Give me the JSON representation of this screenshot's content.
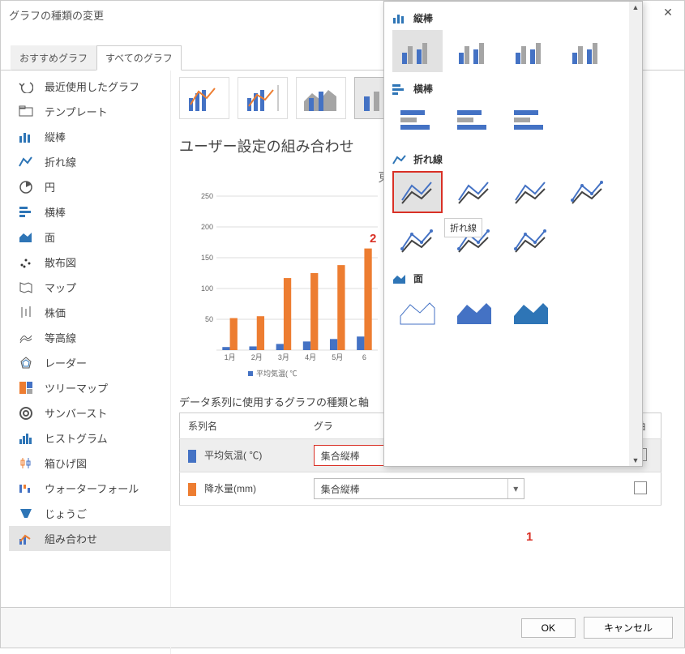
{
  "dialog": {
    "title": "グラフの種類の変更"
  },
  "tabs": {
    "recommended": "おすすめグラフ",
    "all": "すべてのグラフ"
  },
  "sidebar": {
    "items": [
      {
        "label": "最近使用したグラフ",
        "icon": "undo-icon"
      },
      {
        "label": "テンプレート",
        "icon": "folder-icon"
      },
      {
        "label": "縦棒",
        "icon": "column-chart-icon"
      },
      {
        "label": "折れ線",
        "icon": "line-chart-icon"
      },
      {
        "label": "円",
        "icon": "pie-chart-icon"
      },
      {
        "label": "横棒",
        "icon": "bar-chart-icon"
      },
      {
        "label": "面",
        "icon": "area-chart-icon"
      },
      {
        "label": "散布図",
        "icon": "scatter-chart-icon"
      },
      {
        "label": "マップ",
        "icon": "map-icon"
      },
      {
        "label": "株価",
        "icon": "stock-chart-icon"
      },
      {
        "label": "等高線",
        "icon": "surface-chart-icon"
      },
      {
        "label": "レーダー",
        "icon": "radar-chart-icon"
      },
      {
        "label": "ツリーマップ",
        "icon": "treemap-icon"
      },
      {
        "label": "サンバースト",
        "icon": "sunburst-icon"
      },
      {
        "label": "ヒストグラム",
        "icon": "histogram-icon"
      },
      {
        "label": "箱ひげ図",
        "icon": "boxplot-icon"
      },
      {
        "label": "ウォーターフォール",
        "icon": "waterfall-icon"
      },
      {
        "label": "じょうご",
        "icon": "funnel-icon"
      },
      {
        "label": "組み合わせ",
        "icon": "combo-chart-icon",
        "selected": true
      }
    ]
  },
  "main": {
    "heading": "ユーザー設定の組み合わせ",
    "preview_title": "東京の降水量と",
    "legend_item": "平均気温( ℃",
    "series_section_heading": "データ系列に使用するグラフの種類と軸",
    "series_cols": {
      "name": "系列名",
      "type": "グラ",
      "axis": "軸"
    },
    "series": [
      {
        "name": "平均気温( ℃)",
        "color": "#4472C4",
        "type": "集合縦棒",
        "axis_checked": false
      },
      {
        "name": "降水量(mm)",
        "color": "#ED7D31",
        "type": "集合縦棒",
        "axis_checked": false
      }
    ]
  },
  "annotations": {
    "callout1": "1",
    "callout2": "2"
  },
  "popup": {
    "groups": [
      {
        "title": "縦棒",
        "icon": "column-chart-icon"
      },
      {
        "title": "横棒",
        "icon": "bar-chart-icon"
      },
      {
        "title": "折れ線",
        "icon": "line-chart-icon",
        "tooltip": "折れ線"
      },
      {
        "title": "面",
        "icon": "area-chart-icon"
      }
    ]
  },
  "footer": {
    "ok": "OK",
    "cancel": "キャンセル"
  },
  "chart_data": {
    "type": "bar",
    "title": "東京の降水量と",
    "categories": [
      "1月",
      "2月",
      "3月",
      "4月",
      "5月",
      "6"
    ],
    "series": [
      {
        "name": "平均気温( ℃)",
        "color": "#4472C4",
        "values": [
          5,
          6,
          10,
          14,
          18,
          22
        ]
      },
      {
        "name": "降水量(mm)",
        "color": "#ED7D31",
        "values": [
          52,
          55,
          117,
          125,
          138,
          165
        ]
      }
    ],
    "ylim": [
      0,
      250
    ],
    "yticks": [
      50,
      100,
      150,
      200,
      250
    ],
    "legend_position": "bottom"
  }
}
